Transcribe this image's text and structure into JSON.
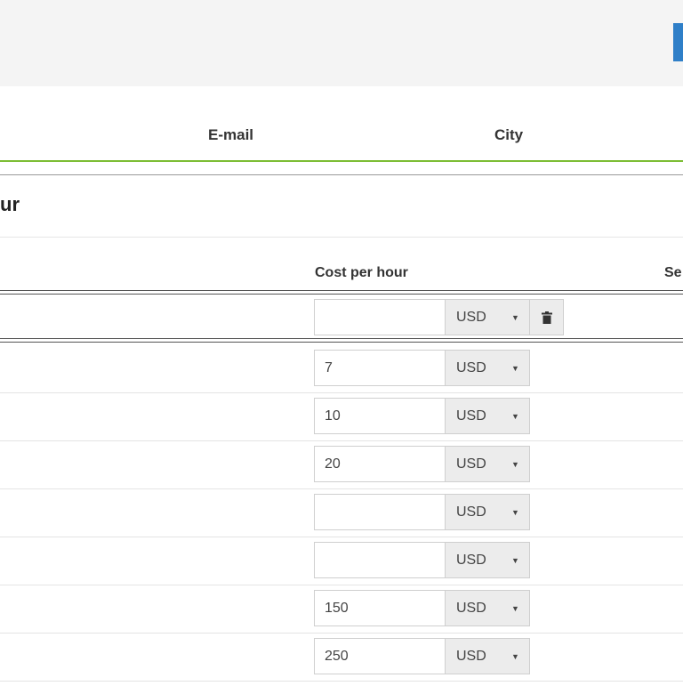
{
  "header": {
    "columns": {
      "email": "E-mail",
      "city": "City"
    }
  },
  "panel": {
    "title": "ur"
  },
  "table": {
    "headers": {
      "cost": "Cost per hour",
      "se": "Se"
    },
    "new_row": {
      "value": "",
      "currency": "USD"
    },
    "rows": [
      {
        "value": "7",
        "currency": "USD"
      },
      {
        "value": "10",
        "currency": "USD"
      },
      {
        "value": "20",
        "currency": "USD"
      },
      {
        "value": "",
        "currency": "USD"
      },
      {
        "value": "",
        "currency": "USD"
      },
      {
        "value": "150",
        "currency": "USD"
      },
      {
        "value": "250",
        "currency": "USD"
      }
    ]
  },
  "icons": {
    "caret": "caret-down-icon",
    "delete": "trash-icon"
  },
  "colors": {
    "accent_green": "#7cbd34",
    "primary_blue": "#2f7fc8"
  }
}
